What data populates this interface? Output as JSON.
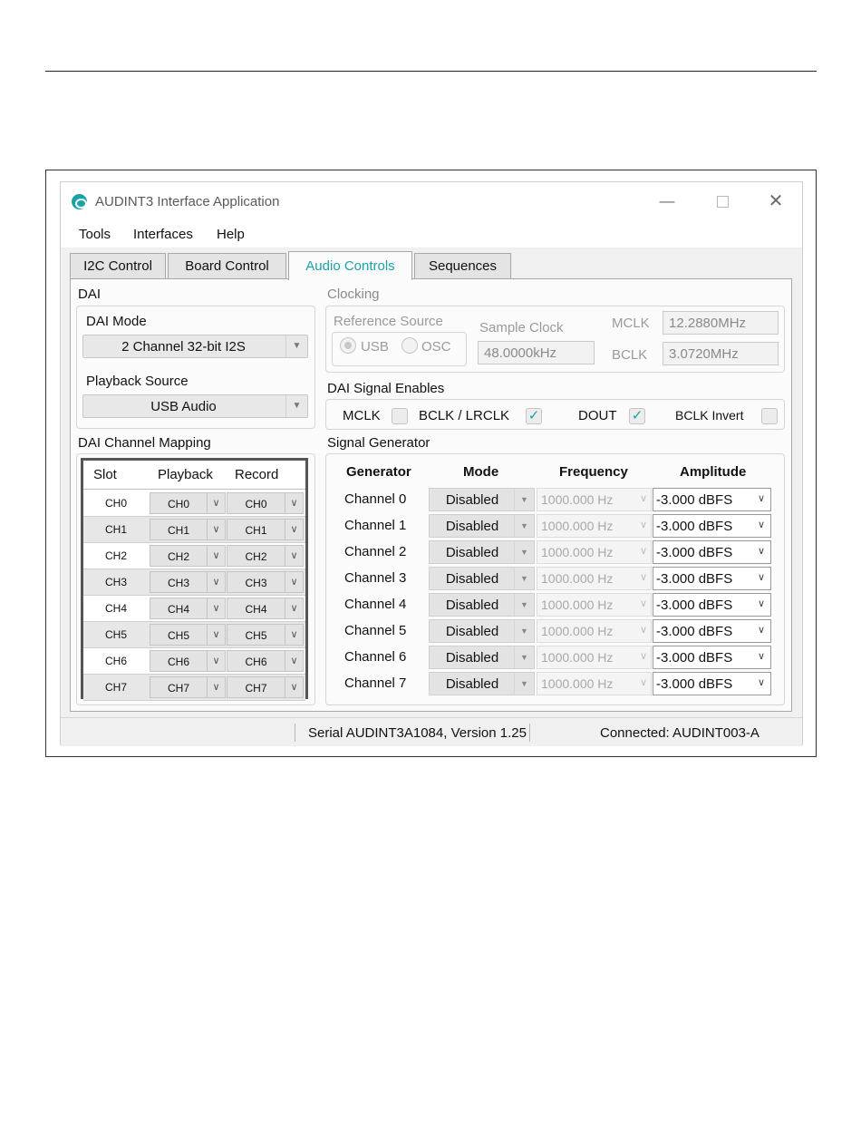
{
  "window": {
    "title": "AUDINT3 Interface Application",
    "controls": {
      "minimize": "—",
      "close": "✕"
    }
  },
  "menu": [
    "Tools",
    "Interfaces",
    "Help"
  ],
  "tabs": [
    {
      "label": "I2C Control",
      "active": false
    },
    {
      "label": "Board Control",
      "active": false
    },
    {
      "label": "Audio Controls",
      "active": true
    },
    {
      "label": "Sequences",
      "active": false
    }
  ],
  "dai": {
    "section_label": "DAI",
    "mode_label": "DAI Mode",
    "mode_value": "2 Channel 32-bit I2S",
    "playback_label": "Playback Source",
    "playback_value": "USB Audio"
  },
  "clocking": {
    "section_label": "Clocking",
    "reference_label": "Reference Source",
    "reference_options": [
      "USB",
      "OSC"
    ],
    "reference_selected": "USB",
    "sample_clock_label": "Sample Clock",
    "sample_clock_value": "48.0000kHz",
    "mclk_label": "MCLK",
    "mclk_value": "12.2880MHz",
    "bclk_label": "BCLK",
    "bclk_value": "3.0720MHz"
  },
  "signal_enables": {
    "section_label": "DAI Signal Enables",
    "items": [
      {
        "label": "MCLK",
        "checked": false
      },
      {
        "label": "BCLK / LRCLK",
        "checked": true
      },
      {
        "label": "DOUT",
        "checked": true
      },
      {
        "label": "BCLK Invert",
        "checked": false
      }
    ],
    "check_glyph": "✓"
  },
  "channel_mapping": {
    "section_label": "DAI Channel Mapping",
    "headers": [
      "Slot",
      "Playback",
      "Record"
    ],
    "rows": [
      {
        "slot": "CH0",
        "playback": "CH0",
        "record": "CH0"
      },
      {
        "slot": "CH1",
        "playback": "CH1",
        "record": "CH1"
      },
      {
        "slot": "CH2",
        "playback": "CH2",
        "record": "CH2"
      },
      {
        "slot": "CH3",
        "playback": "CH3",
        "record": "CH3"
      },
      {
        "slot": "CH4",
        "playback": "CH4",
        "record": "CH4"
      },
      {
        "slot": "CH5",
        "playback": "CH5",
        "record": "CH5"
      },
      {
        "slot": "CH6",
        "playback": "CH6",
        "record": "CH6"
      },
      {
        "slot": "CH7",
        "playback": "CH7",
        "record": "CH7"
      }
    ]
  },
  "signal_generator": {
    "section_label": "Signal Generator",
    "headers": [
      "Generator",
      "Mode",
      "Frequency",
      "Amplitude"
    ],
    "rows": [
      {
        "channel": "Channel 0",
        "mode": "Disabled",
        "frequency": "1000.000 Hz",
        "amplitude": "-3.000 dBFS"
      },
      {
        "channel": "Channel 1",
        "mode": "Disabled",
        "frequency": "1000.000 Hz",
        "amplitude": "-3.000 dBFS"
      },
      {
        "channel": "Channel 2",
        "mode": "Disabled",
        "frequency": "1000.000 Hz",
        "amplitude": "-3.000 dBFS"
      },
      {
        "channel": "Channel 3",
        "mode": "Disabled",
        "frequency": "1000.000 Hz",
        "amplitude": "-3.000 dBFS"
      },
      {
        "channel": "Channel 4",
        "mode": "Disabled",
        "frequency": "1000.000 Hz",
        "amplitude": "-3.000 dBFS"
      },
      {
        "channel": "Channel 5",
        "mode": "Disabled",
        "frequency": "1000.000 Hz",
        "amplitude": "-3.000 dBFS"
      },
      {
        "channel": "Channel 6",
        "mode": "Disabled",
        "frequency": "1000.000 Hz",
        "amplitude": "-3.000 dBFS"
      },
      {
        "channel": "Channel 7",
        "mode": "Disabled",
        "frequency": "1000.000 Hz",
        "amplitude": "-3.000 dBFS"
      }
    ]
  },
  "status": {
    "serial_version": "Serial AUDINT3A1084, Version 1.25",
    "connection": "Connected: AUDINT003-A"
  },
  "icons": {
    "combo_arrow": "▼",
    "chevron": "∨"
  },
  "colors": {
    "accent": "#1aa1ab",
    "logo": "#18a4a6"
  }
}
